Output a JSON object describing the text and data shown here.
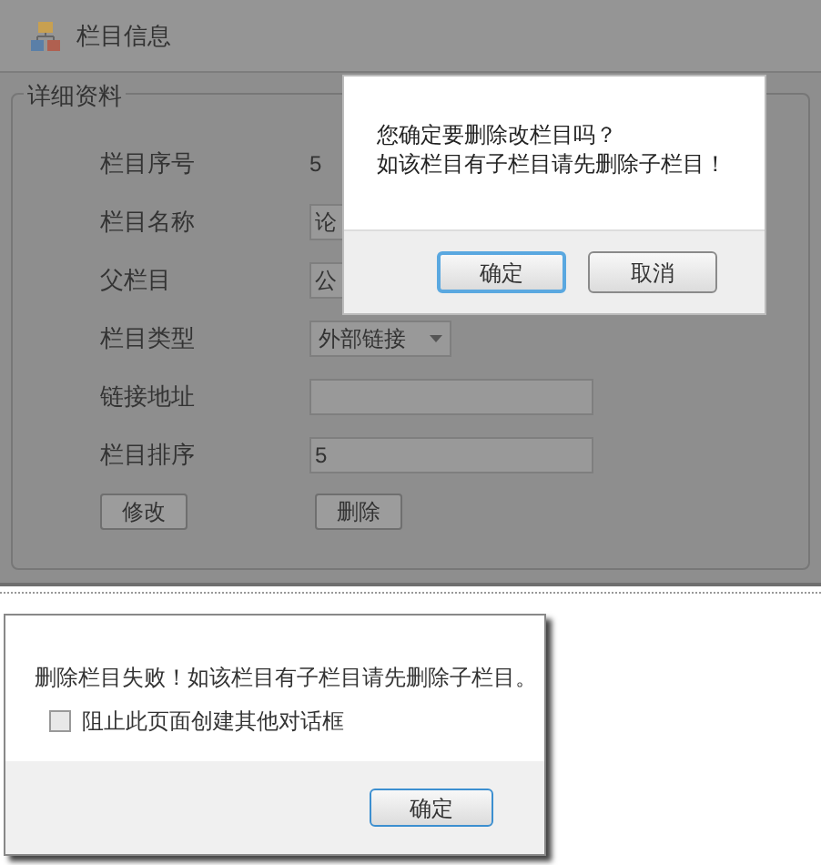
{
  "panel": {
    "title": "栏目信息",
    "fieldset": "详细资料",
    "fields": [
      {
        "label": "栏目序号",
        "kind": "text",
        "value": "5"
      },
      {
        "label": "栏目名称",
        "kind": "input",
        "value": "论"
      },
      {
        "label": "父栏目",
        "kind": "input",
        "value": "公"
      },
      {
        "label": "栏目类型",
        "kind": "select",
        "value": "外部链接"
      },
      {
        "label": "链接地址",
        "kind": "input"
      },
      {
        "label": "栏目排序",
        "kind": "input",
        "value": "5"
      }
    ],
    "buttons": [
      "修改",
      "删除"
    ]
  },
  "confirm_dialog": {
    "lines": [
      "您确定要删除改栏目吗？",
      "如该栏目有子栏目请先删除子栏目！"
    ],
    "buttons": [
      {
        "label": "确定",
        "focused": true
      },
      {
        "label": "取消",
        "focused": false
      }
    ]
  },
  "alert_dialog": {
    "message": "删除栏目失败！如该栏目有子栏目请先删除子栏目。",
    "checkbox": {
      "label": "阻止此页面创建其他对话框",
      "checked": false
    },
    "button": "确定"
  }
}
